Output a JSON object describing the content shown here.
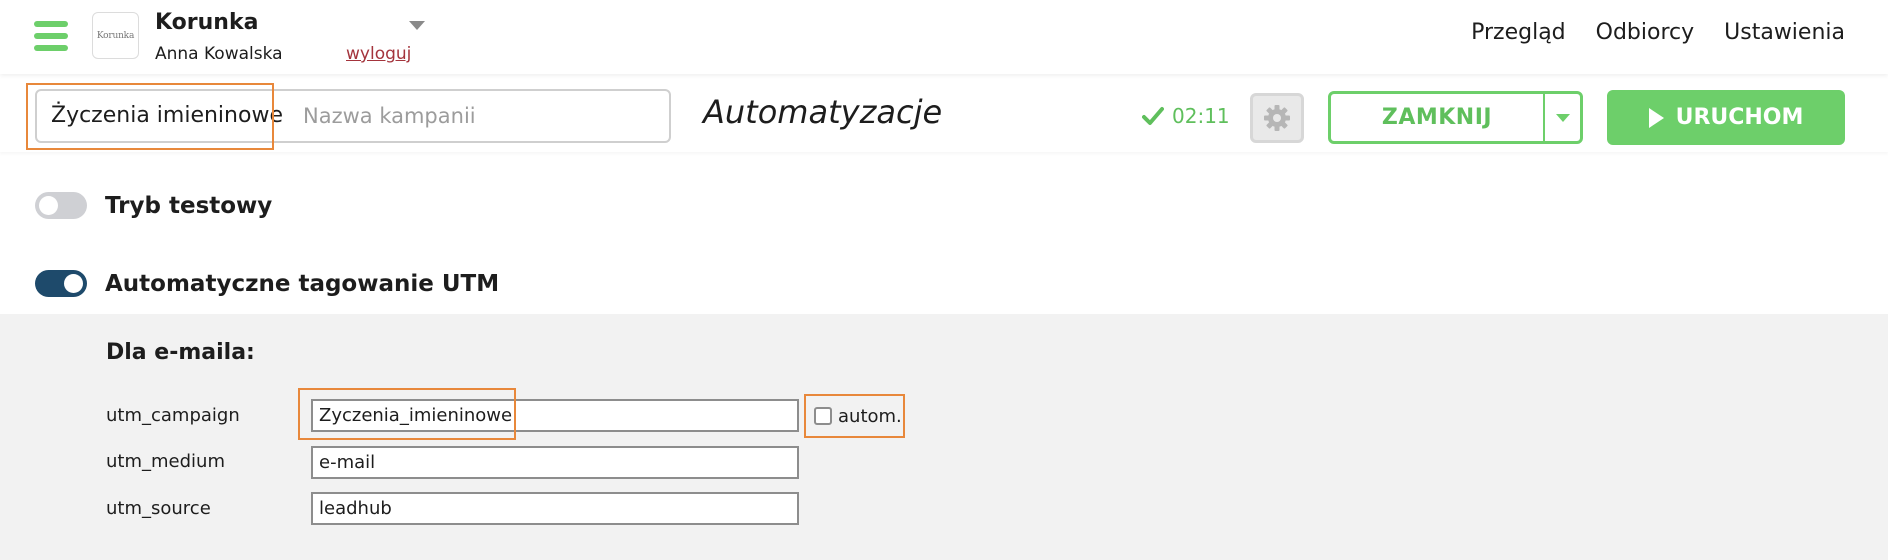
{
  "header": {
    "brand_name": "Korunka",
    "logo_text": "Korunka",
    "user_name": "Anna Kowalska",
    "logout_label": "wyloguj",
    "nav": [
      {
        "label": "Przegląd"
      },
      {
        "label": "Odbiorcy"
      },
      {
        "label": "Ustawienia"
      }
    ]
  },
  "toolbar": {
    "campaign_name": "Życzenia imieninowe",
    "campaign_name_placeholder": "Nazwa kampanii",
    "page_title": "Automatyzacje",
    "saved_time": "02:11",
    "close_label": "ZAMKNIJ",
    "run_label": "URUCHOM"
  },
  "settings": {
    "test_mode": {
      "label": "Tryb testowy",
      "enabled": false
    },
    "utm_tagging": {
      "label": "Automatyczne tagowanie UTM",
      "enabled": true
    }
  },
  "utm": {
    "heading": "Dla e-maila:",
    "fields": [
      {
        "label": "utm_campaign",
        "value": "Zyczenia_imieninowe"
      },
      {
        "label": "utm_medium",
        "value": "e-mail"
      },
      {
        "label": "utm_source",
        "value": "leadhub"
      }
    ],
    "auto_label": "autom.",
    "auto_checked": false
  },
  "colors": {
    "accent_green": "#6dcf6a",
    "toggle_on": "#1e4a6b",
    "highlight_orange": "#e8883b",
    "logout_red": "#a4343c"
  }
}
